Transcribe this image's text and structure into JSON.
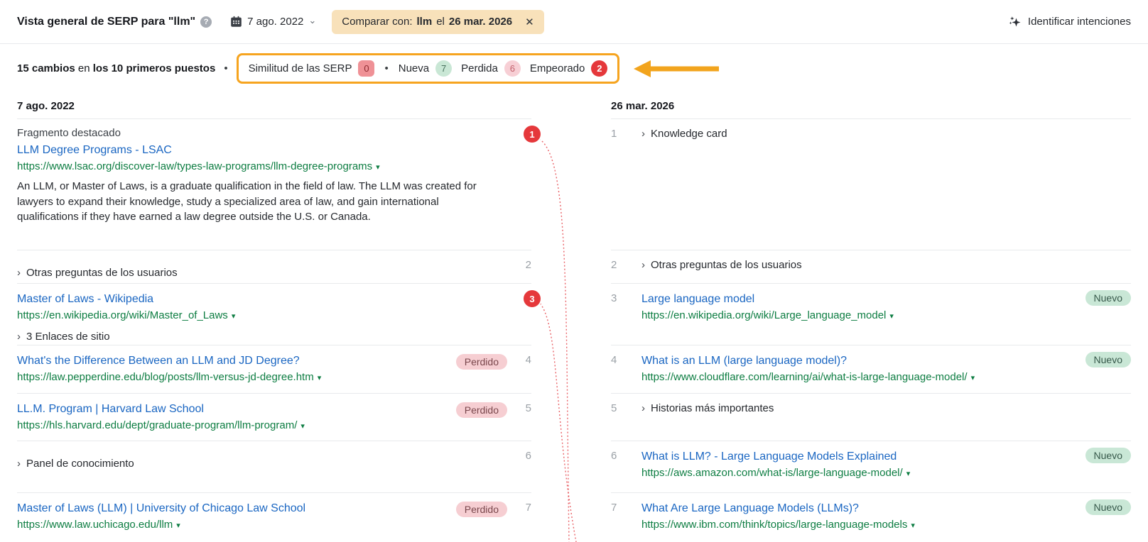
{
  "header": {
    "title": "Vista general de SERP para \"llm\"",
    "date_label": "7 ago. 2022",
    "compare": {
      "prefix": "Comparar con:",
      "keyword": "llm",
      "middle": "el",
      "date": "26 mar. 2026"
    },
    "identify_intents_label": "Identificar intenciones"
  },
  "stats": {
    "changes_bold": "15 cambios",
    "changes_mid": "en",
    "changes_bold2": "los 10 primeros puestos",
    "metrics": [
      {
        "label": "Similitud de las SERP",
        "value": "0"
      },
      {
        "label": "Nueva",
        "value": "7"
      },
      {
        "label": "Perdida",
        "value": "6"
      },
      {
        "label": "Empeorado",
        "value": "2"
      }
    ]
  },
  "columns": {
    "left": {
      "date": "7 ago. 2022",
      "items": [
        {
          "type_label": "Fragmento destacado",
          "title": "LLM Degree Programs - LSAC",
          "url": "https://www.lsac.org/discover-law/types-law-programs/llm-degree-programs",
          "description": "An LLM, or Master of Laws, is a graduate qualification in the field of law. The LLM was created for lawyers to expand their knowledge, study a specialized area of law, and gain international qualifications if they have earned a law degree outside the U.S. or Canada.",
          "marker": "1"
        },
        {
          "feature": "Otras preguntas de los usuarios",
          "position": "2"
        },
        {
          "title": "Master of Laws - Wikipedia",
          "url": "https://en.wikipedia.org/wiki/Master_of_Laws",
          "sitelinks": "3 Enlaces de sitio",
          "marker": "3"
        },
        {
          "title": "What's the Difference Between an LLM and JD Degree?",
          "url": "https://law.pepperdine.edu/blog/posts/llm-versus-jd-degree.htm",
          "badge": "Perdido",
          "position": "4"
        },
        {
          "title": "LL.M. Program | Harvard Law School",
          "url": "https://hls.harvard.edu/dept/graduate-program/llm-program/",
          "badge": "Perdido",
          "position": "5"
        },
        {
          "feature": "Panel de conocimiento",
          "position": "6"
        },
        {
          "title": "Master of Laws (LLM) | University of Chicago Law School",
          "url": "https://www.law.uchicago.edu/llm",
          "badge": "Perdido",
          "position": "7"
        }
      ]
    },
    "right": {
      "date": "26 mar. 2026",
      "items": [
        {
          "position": "1",
          "feature": "Knowledge card"
        },
        {
          "position": "2",
          "feature": "Otras preguntas de los usuarios"
        },
        {
          "position": "3",
          "title": "Large language model",
          "url": "https://en.wikipedia.org/wiki/Large_language_model",
          "badge": "Nuevo"
        },
        {
          "position": "4",
          "title": "What is an LLM (large language model)?",
          "url": "https://www.cloudflare.com/learning/ai/what-is-large-language-model/",
          "badge": "Nuevo"
        },
        {
          "position": "5",
          "feature": "Historias más importantes"
        },
        {
          "position": "6",
          "title": "What is LLM? - Large Language Models Explained",
          "url": "https://aws.amazon.com/what-is/large-language-model/",
          "badge": "Nuevo"
        },
        {
          "position": "7",
          "title": "What Are Large Language Models (LLMs)?",
          "url": "https://www.ibm.com/think/topics/large-language-models",
          "badge": "Nuevo"
        }
      ]
    }
  },
  "icons": {
    "help": "?",
    "chevron_down": "⌄",
    "close": "✕",
    "bullet": "•",
    "chevron_expand": "›",
    "url_caret": "▾"
  },
  "colors": {
    "accent_orange": "#f6a41f",
    "highlight_pill_bg": "#f8e1ba",
    "marker_red": "#e5383b",
    "lost_badge_bg": "#f6ced2",
    "lost_badge_text": "#79474c",
    "new_badge_bg": "#c9e7d6",
    "new_badge_text": "#36584a",
    "link_blue": "#1a66c2",
    "url_green": "#0d7d42",
    "connector_red": "#e5484d"
  }
}
